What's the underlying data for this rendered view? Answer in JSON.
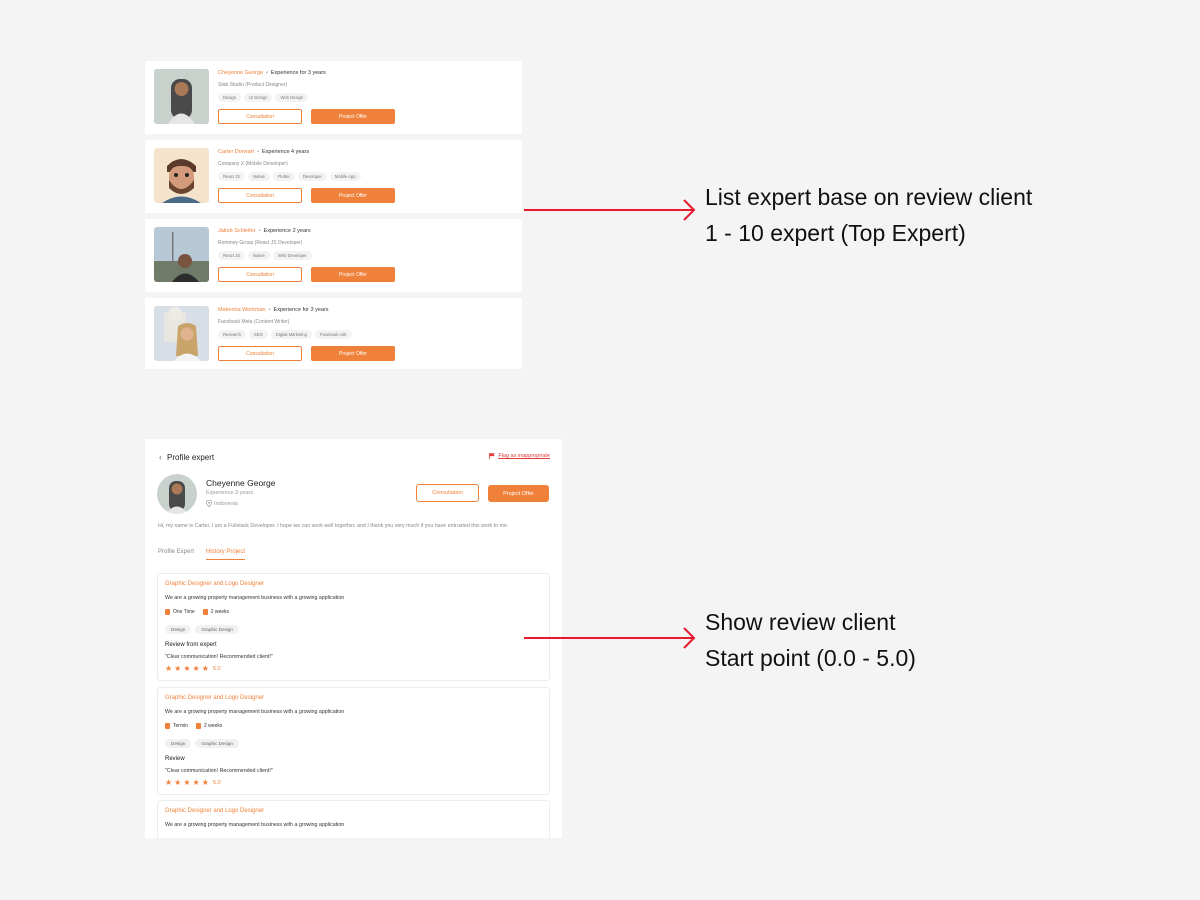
{
  "expert_list": [
    {
      "name": "Cheyenne George",
      "experience": "Experience for 3 years",
      "company": "Stab Studio (Product Designer)",
      "tags": [
        "Design",
        "UI Design",
        "Web Design"
      ],
      "avatar_bg": "#c8d0cc"
    },
    {
      "name": "Carter Dorwart",
      "experience": "Experience 4 years",
      "company": "Company X (Mobile Developer)",
      "tags": [
        "React JS",
        "Native",
        "Flutter",
        "Developer",
        "Mobile App"
      ],
      "avatar_bg": "#f5e2c9"
    },
    {
      "name": "Jakob Schleifer",
      "experience": "Experience 2 years",
      "company": "Rommey Group (React JS Developer)",
      "tags": [
        "React JS",
        "Native",
        "Web Developer"
      ],
      "avatar_bg": "#b9c9d6"
    },
    {
      "name": "Makenna Workman",
      "experience": "Experience for 3 years",
      "company": "Facebook Meta (Content Writer)",
      "tags": [
        "Research",
        "SEO",
        "Digital Marketing",
        "Facebook Ads"
      ],
      "avatar_bg": "#d6dce4"
    }
  ],
  "buttons": {
    "consultation": "Consultation",
    "project_offer": "Project Offer"
  },
  "profile": {
    "back_label": "Profile expert",
    "flag_label": "Flag as inappropriate",
    "name": "Cheyenne George",
    "experience": "Experience 3 years",
    "location": "Indonesia",
    "bio": "Hi, my name is Carter. I am a Fullstack Developer. I hope we can work well together, and I thank you very much if you have entrusted this work to me.",
    "tabs": [
      "Profile Expert",
      "History Project"
    ]
  },
  "projects": [
    {
      "title": "Graphic Designer and Logo Designer",
      "description": "We are a growing property management business with a growing application",
      "type": "One Time",
      "duration": "2 weeks",
      "tags": [
        "Design",
        "Graphic Design"
      ],
      "review_heading": "Review from expert",
      "review_text": "\"Clear communication! Recommended client!\"",
      "rating": "5.0"
    },
    {
      "title": "Graphic Designer and Logo Designer",
      "description": "We are a growing property management business with a growing application",
      "type": "Termin",
      "duration": "2 weeks",
      "tags": [
        "Design",
        "Graphic Design"
      ],
      "review_heading": "Review",
      "review_text": "\"Clear communication! Recommended client!\"",
      "rating": "5.0"
    },
    {
      "title": "Graphic Designer and Logo Designer",
      "description": "We are a growing property management business with a growing application"
    }
  ],
  "annotations": {
    "top": [
      "List expert base on review client",
      "1 - 10 expert (Top Expert)"
    ],
    "bottom": [
      "Show review client",
      "Start point (0.0 - 5.0)"
    ]
  },
  "colors": {
    "accent": "#f0813a",
    "arrow": "#e8192c",
    "flag": "#e53b3b"
  }
}
